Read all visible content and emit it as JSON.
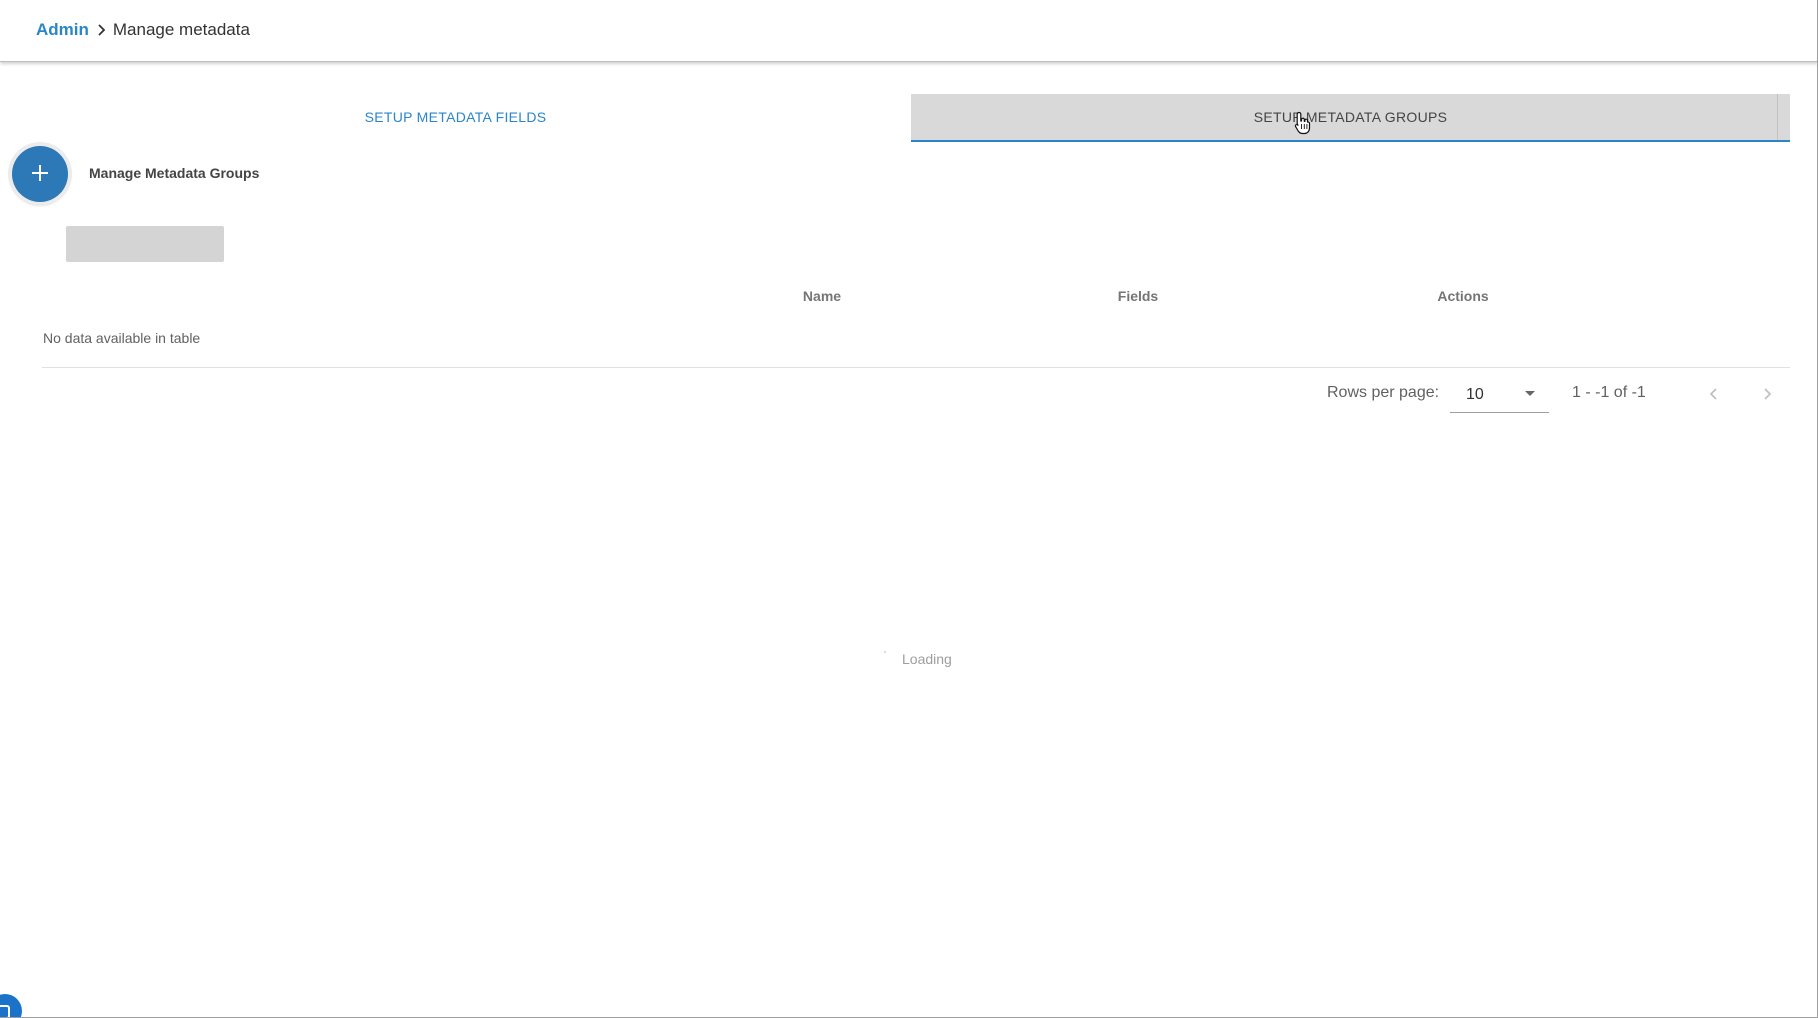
{
  "breadcrumb": {
    "root": "Admin",
    "current": "Manage metadata"
  },
  "tabs": [
    {
      "label": "SETUP METADATA FIELDS",
      "selected": false
    },
    {
      "label": "SETUP METADATA GROUPS",
      "selected": true
    }
  ],
  "groups": {
    "add_icon": "plus-icon",
    "title": "Manage Metadata Groups"
  },
  "table": {
    "columns": [
      "Name",
      "Fields",
      "Actions"
    ],
    "empty_message": "No data available in table"
  },
  "pagination": {
    "rows_per_page_label": "Rows per page:",
    "rows_per_page_value": "10",
    "range": "1 - -1 of -1",
    "prev_icon": "chevron-left-icon",
    "next_icon": "chevron-right-icon"
  },
  "loading_text": "Loading",
  "colors": {
    "accent": "#2a86c8",
    "fab": "#2d78b6",
    "selected_tab_bg": "#d9d9d9",
    "corner_widget": "#1a73c9"
  }
}
